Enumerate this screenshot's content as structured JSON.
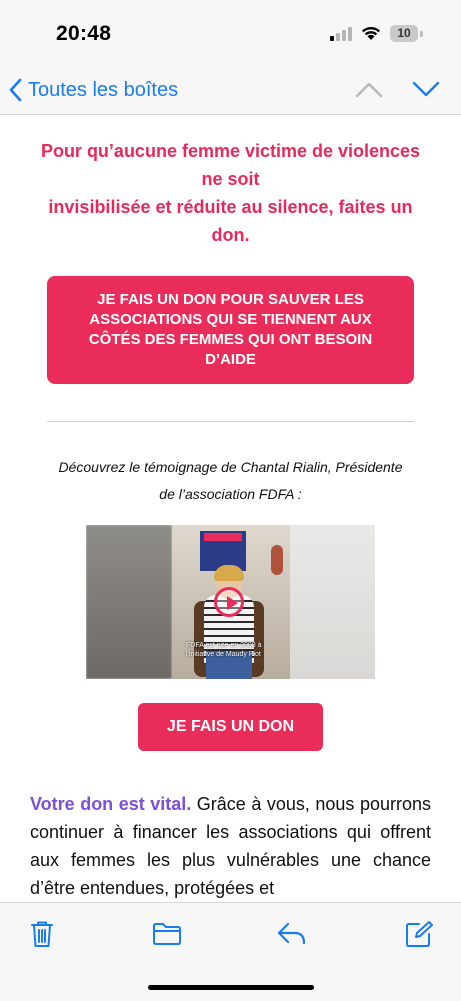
{
  "status_bar": {
    "time": "20:48",
    "battery": "10"
  },
  "nav": {
    "back_label": "Toutes les boîtes"
  },
  "email": {
    "headline_lines": [
      "Pour qu’aucune femme victime de violences",
      "ne soit",
      "invisibilisée et réduite au silence, faites un",
      "don."
    ],
    "cta_big_label": "JE FAIS UN DON POUR SAUVER LES ASSOCIATIONS QUI SE TIENNENT AUX CÔTÉS DES FEMMES QUI ONT BESOIN D’AIDE",
    "intro_lines": [
      "Découvrez le témoignage de Chantal Rialin, Présidente",
      "de l’association FDFA :"
    ],
    "video_caption": "FDFA est née en 2008 à l'initiative de Maudy Piot",
    "cta_small_label": "JE FAIS UN DON",
    "paragraph": {
      "highlight": "Votre don est vital.",
      "text": " Grâce à vous, nous pourrons continuer à financer les associations qui offrent aux femmes les plus vulnérables une chance d’être entendues, protégées et"
    }
  },
  "colors": {
    "accent": "#ea2c5b",
    "link": "#1a7cf1",
    "highlight": "#7b4fd6"
  },
  "toolbar": {
    "icons": [
      "trash-icon",
      "folder-icon",
      "reply-icon",
      "compose-icon"
    ]
  }
}
